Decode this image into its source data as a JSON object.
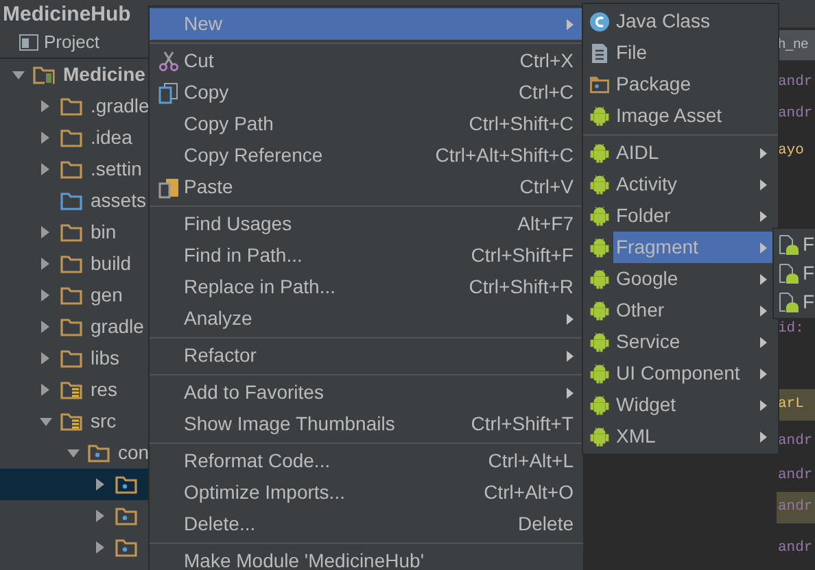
{
  "breadcrumb": {
    "title": "MedicineHub"
  },
  "project_panel": {
    "tab": "Project",
    "tree": [
      {
        "label": "Medicine",
        "kind": "module",
        "expanded": true,
        "selected": false,
        "children": [
          {
            "label": ".gradle",
            "kind": "folder",
            "expanded": false,
            "selected": false
          },
          {
            "label": ".idea",
            "kind": "folder",
            "expanded": false,
            "selected": false
          },
          {
            "label": ".settin",
            "kind": "folder",
            "expanded": false,
            "selected": false
          },
          {
            "label": "assets",
            "kind": "assets",
            "selected": false
          },
          {
            "label": "bin",
            "kind": "folder",
            "expanded": false,
            "selected": false
          },
          {
            "label": "build",
            "kind": "folder",
            "expanded": false,
            "selected": false
          },
          {
            "label": "gen",
            "kind": "folder",
            "expanded": false,
            "selected": false
          },
          {
            "label": "gradle",
            "kind": "folder",
            "expanded": false,
            "selected": false
          },
          {
            "label": "libs",
            "kind": "folder",
            "expanded": false,
            "selected": false
          },
          {
            "label": "res",
            "kind": "resources",
            "expanded": false,
            "selected": false
          },
          {
            "label": "src",
            "kind": "resources",
            "expanded": true,
            "selected": false,
            "children": [
              {
                "label": "con",
                "kind": "package",
                "expanded": true,
                "selected": false,
                "children": [
                  {
                    "kind": "package",
                    "expanded": false,
                    "selected": true
                  },
                  {
                    "kind": "package",
                    "expanded": false,
                    "selected": false
                  },
                  {
                    "kind": "package",
                    "expanded": false,
                    "selected": false
                  }
                ]
              }
            ]
          }
        ]
      }
    ]
  },
  "editor": {
    "tab": "h_ne",
    "lines": [
      {
        "text": "andr",
        "color": "#9876aa",
        "highlighted": false
      },
      {
        "text": "andr",
        "color": "#9876aa",
        "highlighted": false
      },
      {
        "text": "ayo",
        "color": "#e8bf6a",
        "highlighted": false
      },
      {
        "text": "id:",
        "color": "#9876aa",
        "highlighted": false
      },
      {
        "text": "arL",
        "color": "#e8bf6a",
        "highlighted": true
      },
      {
        "text": "andr",
        "color": "#9876aa",
        "highlighted": false
      },
      {
        "text": "andr",
        "color": "#9876aa",
        "highlighted": false
      },
      {
        "text": "andr",
        "color": "#9876aa",
        "highlighted": true
      },
      {
        "text": "andr",
        "color": "#9876aa",
        "highlighted": false
      }
    ]
  },
  "context_menu": {
    "items": [
      {
        "kind": "item",
        "label": "New",
        "submenu": true,
        "selected": true
      },
      {
        "kind": "separator"
      },
      {
        "kind": "item",
        "label": "Cut",
        "shortcut": "Ctrl+X",
        "selected": false
      },
      {
        "kind": "item",
        "label": "Copy",
        "shortcut": "Ctrl+C",
        "selected": false
      },
      {
        "kind": "item",
        "label": "Copy Path",
        "shortcut": "Ctrl+Shift+C",
        "selected": false
      },
      {
        "kind": "item",
        "label": "Copy Reference",
        "shortcut": "Ctrl+Alt+Shift+C",
        "selected": false
      },
      {
        "kind": "item",
        "label": "Paste",
        "shortcut": "Ctrl+V",
        "selected": false
      },
      {
        "kind": "separator"
      },
      {
        "kind": "item",
        "label": "Find Usages",
        "shortcut": "Alt+F7",
        "selected": false
      },
      {
        "kind": "item",
        "label": "Find in Path...",
        "shortcut": "Ctrl+Shift+F",
        "selected": false
      },
      {
        "kind": "item",
        "label": "Replace in Path...",
        "shortcut": "Ctrl+Shift+R",
        "selected": false
      },
      {
        "kind": "item",
        "label": "Analyze",
        "submenu": true,
        "selected": false
      },
      {
        "kind": "separator"
      },
      {
        "kind": "item",
        "label": "Refactor",
        "submenu": true,
        "selected": false
      },
      {
        "kind": "separator"
      },
      {
        "kind": "item",
        "label": "Add to Favorites",
        "submenu": true,
        "selected": false
      },
      {
        "kind": "item",
        "label": "Show Image Thumbnails",
        "shortcut": "Ctrl+Shift+T",
        "selected": false
      },
      {
        "kind": "separator"
      },
      {
        "kind": "item",
        "label": "Reformat Code...",
        "shortcut": "Ctrl+Alt+L",
        "selected": false
      },
      {
        "kind": "item",
        "label": "Optimize Imports...",
        "shortcut": "Ctrl+Alt+O",
        "selected": false
      },
      {
        "kind": "item",
        "label": "Delete...",
        "shortcut": "Delete",
        "selected": false
      },
      {
        "kind": "separator"
      },
      {
        "kind": "item",
        "label": "Make Module 'MedicineHub'",
        "selected": false
      }
    ]
  },
  "new_submenu": {
    "items": [
      {
        "kind": "item",
        "label": "Java Class",
        "selected": false
      },
      {
        "kind": "item",
        "label": "File",
        "selected": false
      },
      {
        "kind": "item",
        "label": "Package",
        "selected": false
      },
      {
        "kind": "item",
        "label": "Image Asset",
        "selected": false
      },
      {
        "kind": "separator"
      },
      {
        "kind": "item",
        "label": "AIDL",
        "submenu": true,
        "selected": false
      },
      {
        "kind": "item",
        "label": "Activity",
        "submenu": true,
        "selected": false
      },
      {
        "kind": "item",
        "label": "Folder",
        "submenu": true,
        "selected": false
      },
      {
        "kind": "item",
        "label": "Fragment",
        "submenu": true,
        "selected": true
      },
      {
        "kind": "item",
        "label": "Google",
        "submenu": true,
        "selected": false
      },
      {
        "kind": "item",
        "label": "Other",
        "submenu": true,
        "selected": false
      },
      {
        "kind": "item",
        "label": "Service",
        "submenu": true,
        "selected": false
      },
      {
        "kind": "item",
        "label": "UI Component",
        "submenu": true,
        "selected": false
      },
      {
        "kind": "item",
        "label": "Widget",
        "submenu": true,
        "selected": false
      },
      {
        "kind": "item",
        "label": "XML",
        "submenu": true,
        "selected": false
      }
    ]
  },
  "fragment_submenu": {
    "items": [
      {
        "label": "F"
      },
      {
        "label": "F"
      },
      {
        "label": "F"
      }
    ]
  }
}
